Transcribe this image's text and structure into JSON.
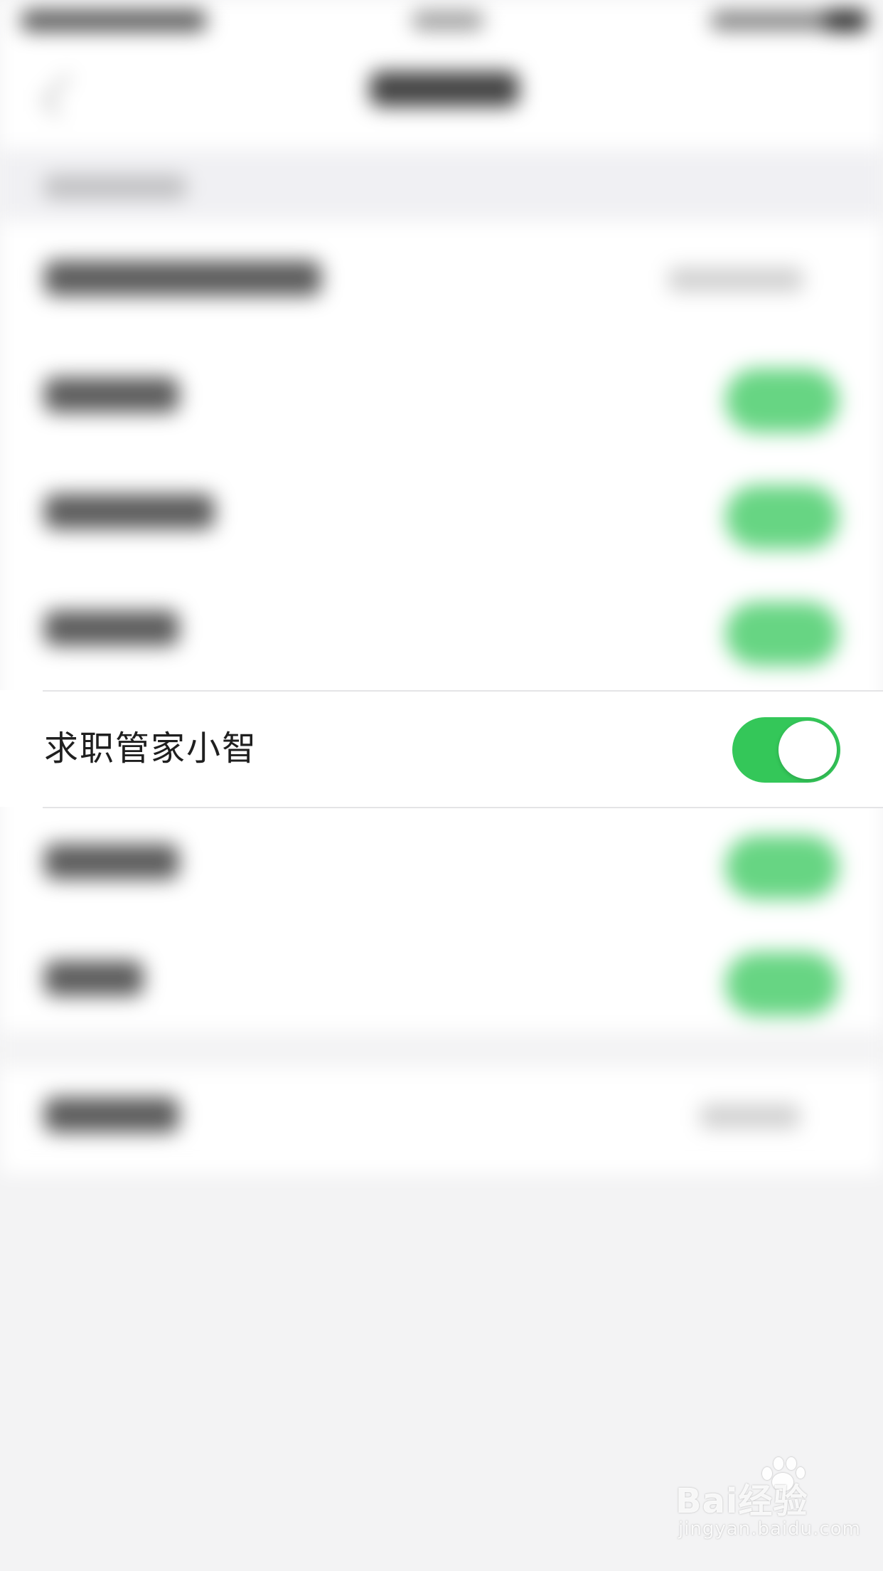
{
  "settings": {
    "focused_row": {
      "label": "求职管家小智",
      "toggle_on": true
    }
  },
  "colors": {
    "toggle_on": "#34c759",
    "background": "#f3f3f4",
    "row_background": "#ffffff",
    "divider": "#e4e4e6"
  },
  "watermark": {
    "logo": "Bai经验",
    "url": "jingyan.baidu.com"
  }
}
